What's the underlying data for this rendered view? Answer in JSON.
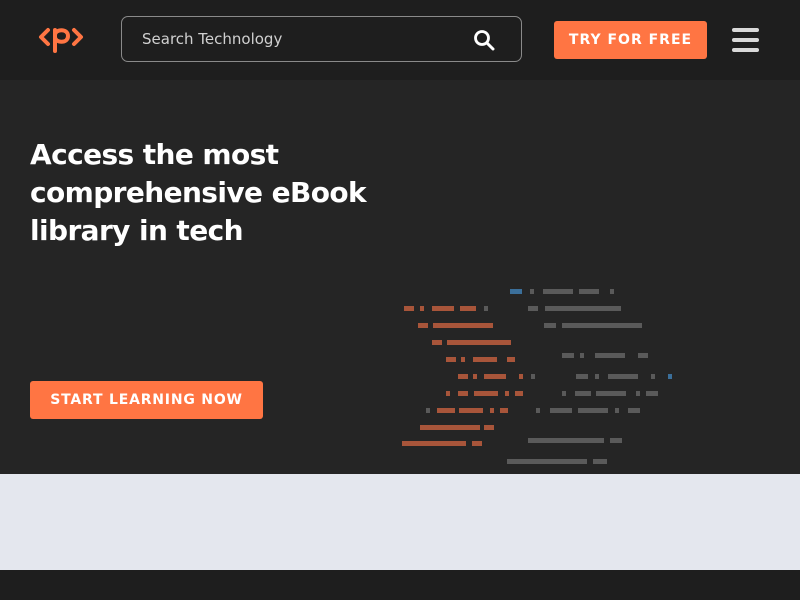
{
  "header": {
    "search": {
      "placeholder": "Search Technology"
    },
    "try_button_label": "TRY FOR FREE"
  },
  "hero": {
    "title": "Access the most comprehensive eBook library in tech",
    "cta_label": "START LEARNING NOW"
  },
  "colors": {
    "accent": "#ff7543",
    "header_bg": "#1e1e1e",
    "hero_bg": "#252525",
    "band_bg": "#e4e7ee"
  },
  "icons": {
    "logo": "packt-logo-icon",
    "search": "search-icon",
    "menu": "hamburger-menu-icon"
  }
}
